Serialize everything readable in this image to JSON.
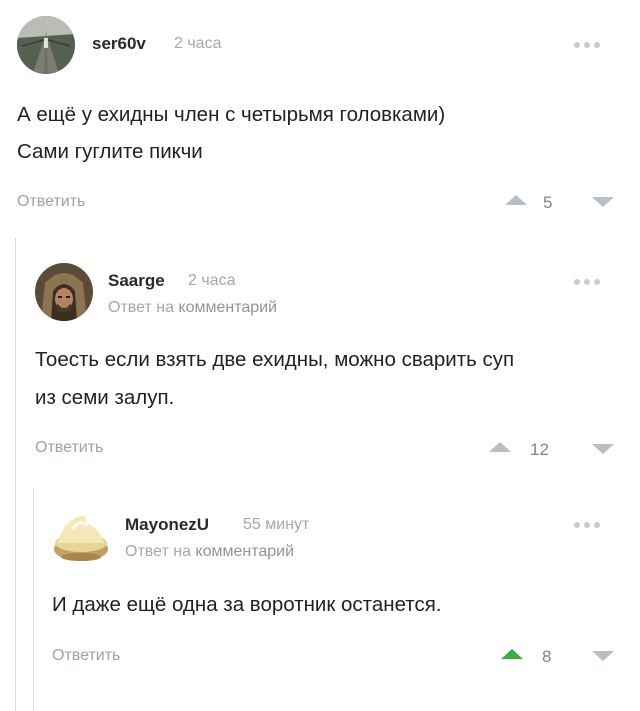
{
  "comments": [
    {
      "username": "ser60v",
      "time": "2 часа",
      "body_lines": [
        "А ещё у ехидны член с четырьмя головками)",
        "Сами гуглите пикчи"
      ],
      "reply_label": "Ответить",
      "score": "5",
      "upvoted": false,
      "avatar_icon": "bridge-photo-avatar"
    },
    {
      "username": "Saarge",
      "time": "2 часа",
      "reply_prefix": "Ответ на",
      "reply_link": "комментарий",
      "body_lines": [
        "Тоесть если взять две ехидны, можно сварить суп",
        "из семи залуп."
      ],
      "reply_label": "Ответить",
      "score": "12",
      "upvoted": false,
      "avatar_icon": "hooded-man-avatar"
    },
    {
      "username": "MayonezU",
      "time": "55 минут",
      "reply_prefix": "Ответ на",
      "reply_link": "комментарий",
      "body_lines": [
        "И даже ещё одна за воротник останется."
      ],
      "reply_label": "Ответить",
      "score": "8",
      "upvoted": true,
      "avatar_icon": "mayonnaise-bowl-avatar"
    }
  ],
  "colors": {
    "upvote_active": "#3dae46",
    "muted": "#a3a8ad",
    "text": "#222222"
  }
}
